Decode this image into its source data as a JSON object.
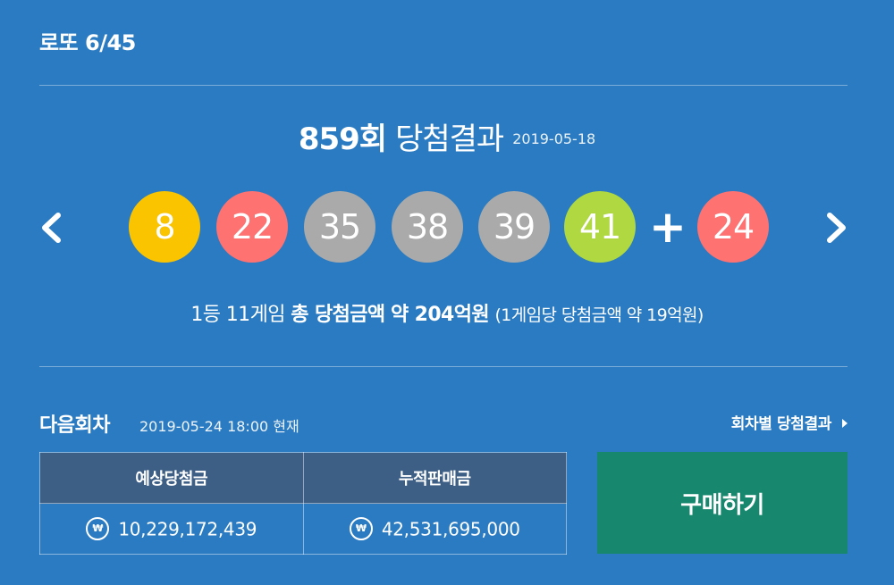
{
  "header": {
    "title": "로또 6/45"
  },
  "draw": {
    "round_number": "859회",
    "round_label": "당첨결과",
    "date": "2019-05-18",
    "plus": "+",
    "numbers": [
      {
        "value": "8",
        "color": "#fbc400"
      },
      {
        "value": "22",
        "color": "#ff7272"
      },
      {
        "value": "35",
        "color": "#aaaaaa"
      },
      {
        "value": "38",
        "color": "#aaaaaa"
      },
      {
        "value": "39",
        "color": "#aaaaaa"
      },
      {
        "value": "41",
        "color": "#b0d840"
      }
    ],
    "bonus": {
      "value": "24",
      "color": "#ff7272"
    }
  },
  "prize": {
    "rank": "1등",
    "games": "11게임",
    "total_label": "총 당첨금액",
    "total_amount": "약 204억원",
    "per_game": "(1게임당 당첨금액 약 19억원)"
  },
  "next_round": {
    "label": "다음회차",
    "date": "2019-05-24 18:00 현재",
    "history_link": "회차별 당첨결과"
  },
  "stats": {
    "headers": [
      "예상당첨금",
      "누적판매금"
    ],
    "currency_icon": "₩",
    "values": [
      "10,229,172,439",
      "42,531,695,000"
    ]
  },
  "actions": {
    "buy_label": "구매하기"
  },
  "colors": {
    "background": "#2a7bc1",
    "table_header": "#3d5f86",
    "buy_button": "#17876e"
  }
}
